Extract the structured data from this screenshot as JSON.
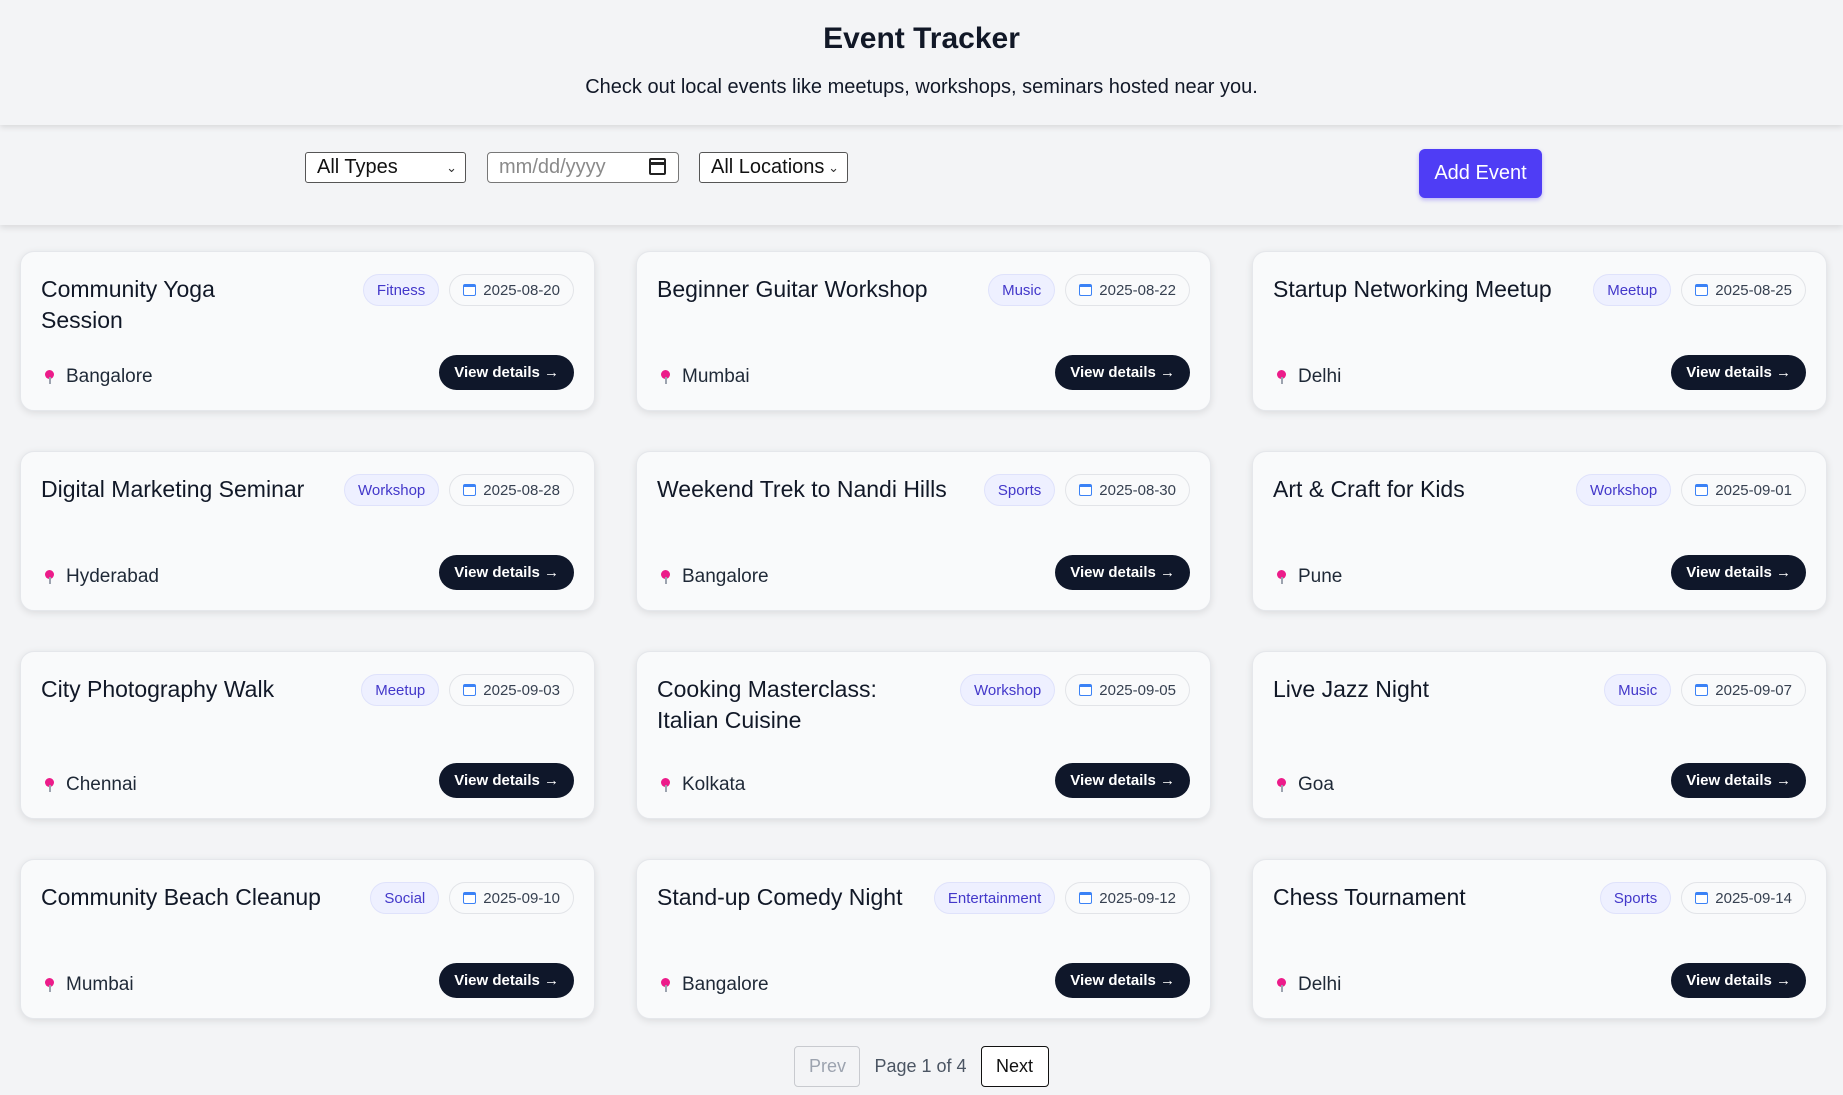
{
  "header": {
    "title": "Event Tracker",
    "subtitle": "Check out local events like meetups, workshops, seminars hosted near you."
  },
  "filters": {
    "type_selected": "All Types",
    "date_placeholder": "mm/dd/yyyy",
    "location_selected": "All Locations"
  },
  "actions": {
    "add_event_label": "Add Event"
  },
  "events": [
    {
      "title": "Community Yoga Session",
      "type": "Fitness",
      "date": "2025-08-20",
      "location": "Bangalore",
      "cta": "View details →"
    },
    {
      "title": "Beginner Guitar Workshop",
      "type": "Music",
      "date": "2025-08-22",
      "location": "Mumbai",
      "cta": "View details →"
    },
    {
      "title": "Startup Networking Meetup",
      "type": "Meetup",
      "date": "2025-08-25",
      "location": "Delhi",
      "cta": "View details →"
    },
    {
      "title": "Digital Marketing Seminar",
      "type": "Workshop",
      "date": "2025-08-28",
      "location": "Hyderabad",
      "cta": "View details →"
    },
    {
      "title": "Weekend Trek to Nandi Hills",
      "type": "Sports",
      "date": "2025-08-30",
      "location": "Bangalore",
      "cta": "View details →"
    },
    {
      "title": "Art & Craft for Kids",
      "type": "Workshop",
      "date": "2025-09-01",
      "location": "Pune",
      "cta": "View details →"
    },
    {
      "title": "City Photography Walk",
      "type": "Meetup",
      "date": "2025-09-03",
      "location": "Chennai",
      "cta": "View details →"
    },
    {
      "title": "Cooking Masterclass: Italian Cuisine",
      "type": "Workshop",
      "date": "2025-09-05",
      "location": "Kolkata",
      "cta": "View details →"
    },
    {
      "title": "Live Jazz Night",
      "type": "Music",
      "date": "2025-09-07",
      "location": "Goa",
      "cta": "View details →"
    },
    {
      "title": "Community Beach Cleanup",
      "type": "Social",
      "date": "2025-09-10",
      "location": "Mumbai",
      "cta": "View details →"
    },
    {
      "title": "Stand-up Comedy Night",
      "type": "Entertainment",
      "date": "2025-09-12",
      "location": "Bangalore",
      "cta": "View details →"
    },
    {
      "title": "Chess Tournament",
      "type": "Sports",
      "date": "2025-09-14",
      "location": "Delhi",
      "cta": "View details →"
    }
  ],
  "pagination": {
    "prev_label": "Prev",
    "info": "Page 1 of 4",
    "next_label": "Next"
  },
  "icons": {
    "date": "calendar-icon",
    "location": "pin-icon",
    "select": "chevron-down-icon"
  },
  "colors": {
    "accent": "#4f3df5",
    "button_dark": "#0f172a",
    "type_badge_text": "#4338ca",
    "pin": "#ec1c8a"
  }
}
